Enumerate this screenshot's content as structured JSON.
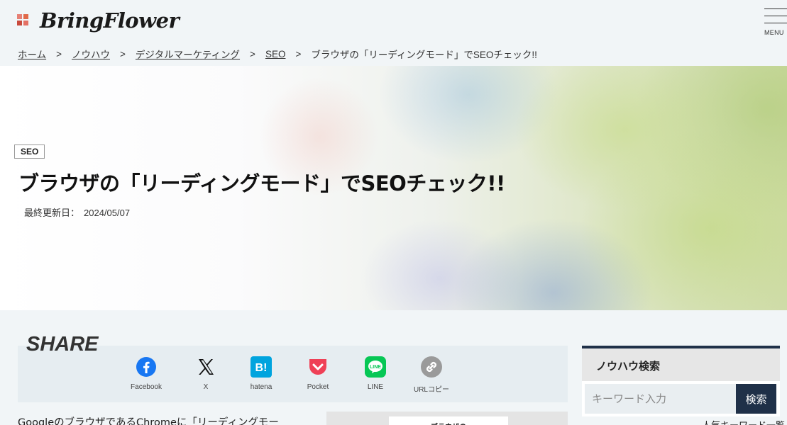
{
  "header": {
    "logo_text": "BringFlower",
    "menu_label": "MENU"
  },
  "breadcrumb": {
    "items": [
      "ホーム",
      "ノウハウ",
      "デジタルマーケティング",
      "SEO"
    ],
    "separator": ">",
    "current": "ブラウザの「リーディングモード」でSEOチェック!!"
  },
  "hero": {
    "category": "SEO",
    "title": "ブラウザの「リーディングモード」でSEOチェック!!",
    "date_label": "最終更新日：",
    "date": "2024/05/07"
  },
  "share": {
    "title": "SHARE",
    "buttons": [
      {
        "label": "Facebook",
        "icon": "facebook-icon",
        "color": "#1877f2"
      },
      {
        "label": "X",
        "icon": "x-icon",
        "color": "#111111"
      },
      {
        "label": "hatena",
        "icon": "hatena-icon",
        "color": "#00a4de"
      },
      {
        "label": "Pocket",
        "icon": "pocket-icon",
        "color": "#ef4056"
      },
      {
        "label": "LINE",
        "icon": "line-icon",
        "color": "#06c755"
      },
      {
        "label": "URLコピー",
        "icon": "link-icon",
        "color": "#999999"
      }
    ]
  },
  "article": {
    "intro": "GoogleのブラウザであるChromeに「リーディングモー",
    "image_caption": "ブラウザの"
  },
  "sidebar": {
    "search_title": "ノウハウ検索",
    "search_placeholder": "キーワード入力",
    "search_button": "検索",
    "next_text": "人気キーワード一覧"
  },
  "colors": {
    "accent_navy": "#1f3048",
    "page_bg": "#f1f5f7"
  }
}
